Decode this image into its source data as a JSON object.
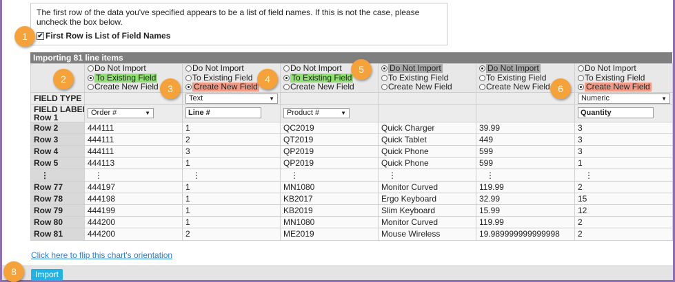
{
  "notice": {
    "text": "The first row of the data you've specified appears to be a list of field names. If this is not the case, please uncheck the box below.",
    "checkbox_label": "First Row is List of Field Names",
    "checkbox_checked": true
  },
  "panel": {
    "title": "Importing 81 line items"
  },
  "options": {
    "do_not_import": "Do Not Import",
    "to_existing": "To Existing Field",
    "create_new": "Create New Field"
  },
  "columns": [
    {
      "selected": "to_existing"
    },
    {
      "selected": "create_new"
    },
    {
      "selected": "to_existing"
    },
    {
      "selected": "do_not_import"
    },
    {
      "selected": "do_not_import"
    },
    {
      "selected": "create_new"
    }
  ],
  "row_labels": {
    "field_type": "FIELD TYPE",
    "field_labels_line1": "FIELD LABELS",
    "field_labels_line2": "Row 1"
  },
  "field_types": {
    "c2": "Text",
    "c6": "Numeric"
  },
  "field_labels": {
    "c1": "Order #",
    "c2": "Line #",
    "c3": "Product #",
    "c6": "Quantity"
  },
  "rows_top": [
    {
      "label": "Row 2",
      "cells": [
        "444111",
        "1",
        "QC2019",
        "Quick Charger",
        "39.99",
        "3"
      ]
    },
    {
      "label": "Row 3",
      "cells": [
        "444111",
        "2",
        "QT2019",
        "Quick Tablet",
        "449",
        "3"
      ]
    },
    {
      "label": "Row 4",
      "cells": [
        "444111",
        "3",
        "QP2019",
        "Quick Phone",
        "599",
        "3"
      ]
    },
    {
      "label": "Row 5",
      "cells": [
        "444113",
        "1",
        "QP2019",
        "Quick Phone",
        "599",
        "1"
      ]
    }
  ],
  "ellipsis": "⋮",
  "rows_bottom": [
    {
      "label": "Row 77",
      "cells": [
        "444197",
        "1",
        "MN1080",
        "Monitor Curved",
        "119.99",
        "2"
      ]
    },
    {
      "label": "Row 78",
      "cells": [
        "444198",
        "1",
        "KB2017",
        "Ergo Keyboard",
        "32.99",
        "15"
      ]
    },
    {
      "label": "Row 79",
      "cells": [
        "444199",
        "1",
        "KB2019",
        "Slim Keyboard",
        "15.99",
        "12"
      ]
    },
    {
      "label": "Row 80",
      "cells": [
        "444200",
        "1",
        "MN1080",
        "Monitor Curved",
        "119.99",
        "2"
      ]
    },
    {
      "label": "Row 81",
      "cells": [
        "444200",
        "2",
        "ME2019",
        "Mouse Wireless",
        "19.989999999999998",
        "2"
      ]
    }
  ],
  "flip_link": "Click here to flip this chart's orientation",
  "import_button": "Import",
  "badges": {
    "b1": "1",
    "b2": "2",
    "b3": "3",
    "b4": "4",
    "b5": "5",
    "b6": "6",
    "b8": "8"
  },
  "colors": {
    "accent": "#1fb3e8",
    "badge": "#f5a23a",
    "highlight_green": "#8ee26e",
    "highlight_red": "#f19a86",
    "frame": "#8e6fb3"
  }
}
